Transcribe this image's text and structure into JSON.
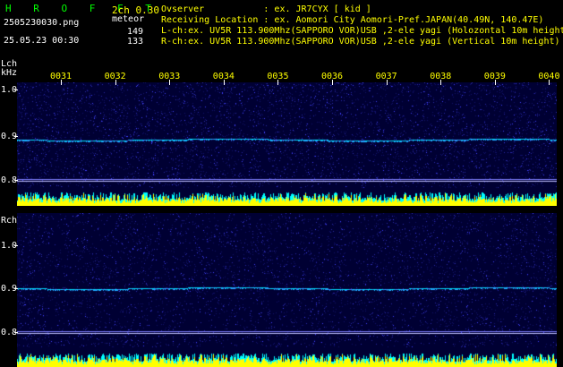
{
  "header": {
    "app_title": "H R O F F T",
    "version": "2ch 0.30",
    "filename": "2505230030.png",
    "mode": "meteor",
    "timestamp": "25.05.23 00:30",
    "count_l": "149",
    "count_r": "133",
    "observer_line": "Ovserver           : ex. JR7CYX [ kid ]",
    "location_line": "Receiving Location : ex. Aomori City Aomori-Pref.JAPAN(40.49N, 140.47E)",
    "lch_line": "L-ch:ex. UV5R 113.900Mhz(SAPPORO VOR)USB ,2-ele yagi (Holozontal 10m height",
    "rch_line": "R-ch:ex. UV5R 113.900Mhz(SAPPORO VOR)USB ,2-ele yagi (Vertical 10m height)"
  },
  "lch": {
    "label": "Lch",
    "unit": "kHz",
    "y_labels": [
      "1.0",
      "0.9",
      "0.8"
    ]
  },
  "rch": {
    "label": "Rch",
    "y_labels": [
      "1.0",
      "0.9",
      "0.8"
    ]
  },
  "minutes": [
    "0031",
    "0032",
    "0033",
    "0034",
    "0035",
    "0036",
    "0037",
    "0038",
    "0039",
    "0040"
  ],
  "colors": {
    "background": "#000000",
    "spectrum_bg": "#000033",
    "header_green": "#00ff00",
    "header_yellow": "#ffff00",
    "signal_line": "#00e0ff",
    "noise_yellow": "#ffff00",
    "noise_cyan": "#00ffff"
  }
}
